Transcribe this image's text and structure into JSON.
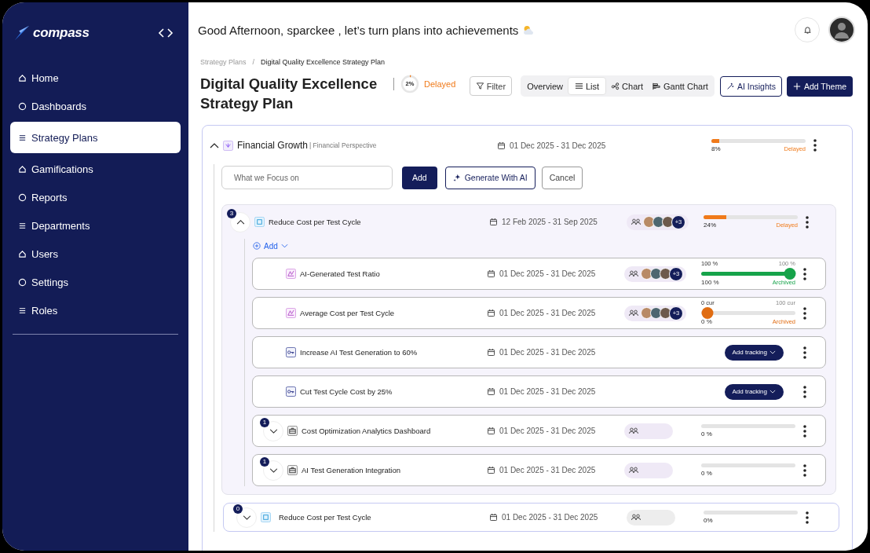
{
  "sidebar": {
    "brand": "compass",
    "items": [
      {
        "label": "Home",
        "selected": false
      },
      {
        "label": "Dashboards",
        "selected": false
      },
      {
        "label": "Strategy Plans",
        "selected": true
      },
      {
        "label": "Gamifications",
        "selected": false
      },
      {
        "label": "Reports",
        "selected": false
      },
      {
        "label": "Departments",
        "selected": false
      },
      {
        "label": "Users",
        "selected": false
      },
      {
        "label": "Settings",
        "selected": false
      },
      {
        "label": "Roles",
        "selected": false
      }
    ]
  },
  "header": {
    "greeting": "Good Afternoon, sparckee , let’s turn plans into achievements"
  },
  "breadcrumb": {
    "items": [
      "Strategy Plans",
      "Digital Quality Excellence Strategy Plan"
    ],
    "separator": "/"
  },
  "plan": {
    "title": "Digital Quality Excellence Strategy Plan",
    "progress": {
      "level": 0.02,
      "value": "2%",
      "status": "Delayed",
      "color": "#f07a1a"
    }
  },
  "toolbar": {
    "filter": "Filter",
    "views": [
      {
        "label": "Overview",
        "selected": false
      },
      {
        "label": "List",
        "selected": true
      },
      {
        "label": "Chart",
        "selected": false
      },
      {
        "label": "Gantt Chart",
        "selected": false
      }
    ],
    "ai_insights": "AI Insights",
    "add_theme": "Add Theme"
  },
  "theme": {
    "expanded": true,
    "name": "Financial Growth",
    "subtitle": "| Financial Perspective",
    "dates": "01 Dec 2025 - 31 Dec 2025",
    "progress": {
      "level": 0.08,
      "value": "8%",
      "status": "Delayed",
      "color": "#f07a1a"
    }
  },
  "focus_form": {
    "placeholder": "What we Focus on",
    "buttons": [
      {
        "label": "Add",
        "kind": "primary"
      },
      {
        "label": "Generate With AI",
        "kind": "ai"
      },
      {
        "label": "Cancel",
        "kind": "secondary"
      }
    ]
  },
  "objective": {
    "count": "3",
    "expanded": true,
    "name": "Reduce Cost per Test Cycle",
    "dates": "12 Feb 2025 - 31 Sep 2025",
    "team_more": "+3",
    "progress": {
      "level": 0.24,
      "value": "24%",
      "status": "Delayed",
      "color": "#f07a1a"
    },
    "add_link": "Add",
    "items": [
      {
        "kind": "metric",
        "name": "AI-Generated Test Ratio",
        "dates": "01 Dec 2025 - 31 Dec 2025",
        "team_more": "+3",
        "metric": {
          "start": "100 %",
          "target": "100 %",
          "value": "100 %",
          "status": "Archived",
          "level": 1,
          "color": "#16a34a"
        }
      },
      {
        "kind": "metric",
        "name": "Average Cost per Test Cycle",
        "dates": "01 Dec 2025 - 31 Dec 2025",
        "team_more": "+3",
        "metric": {
          "start": "0 cur",
          "target": "100 cur",
          "value": "0 %",
          "status": "Archived",
          "level": 0,
          "color": "#e06c12"
        }
      },
      {
        "kind": "tracking",
        "name": "Increase AI Test Generation to 60%",
        "dates": "01 Dec 2025 - 31 Dec 2025",
        "action": "Add tracking"
      },
      {
        "kind": "tracking",
        "name": "Cut Test Cycle Cost by 25%",
        "dates": "01 Dec 2025 - 31 Dec 2025",
        "action": "Add tracking"
      },
      {
        "kind": "initiative",
        "count": "1",
        "expanded": false,
        "name": "Cost Optimization Analytics Dashboard",
        "dates": "01 Dec 2025 - 31 Dec 2025",
        "progress": {
          "level": 0,
          "value": "0 %"
        }
      },
      {
        "kind": "initiative",
        "count": "1",
        "expanded": false,
        "name": "AI Test Generation Integration",
        "dates": "01 Dec 2025 - 31 Dec 2025",
        "progress": {
          "level": 0,
          "value": "0 %"
        }
      }
    ]
  },
  "next_objective": {
    "count": "0",
    "expanded": false,
    "name": "Reduce Cost per Test Cycle",
    "dates": "01 Dec 2025 - 31 Dec 2025",
    "progress": {
      "level": 0,
      "value": "0%"
    }
  }
}
